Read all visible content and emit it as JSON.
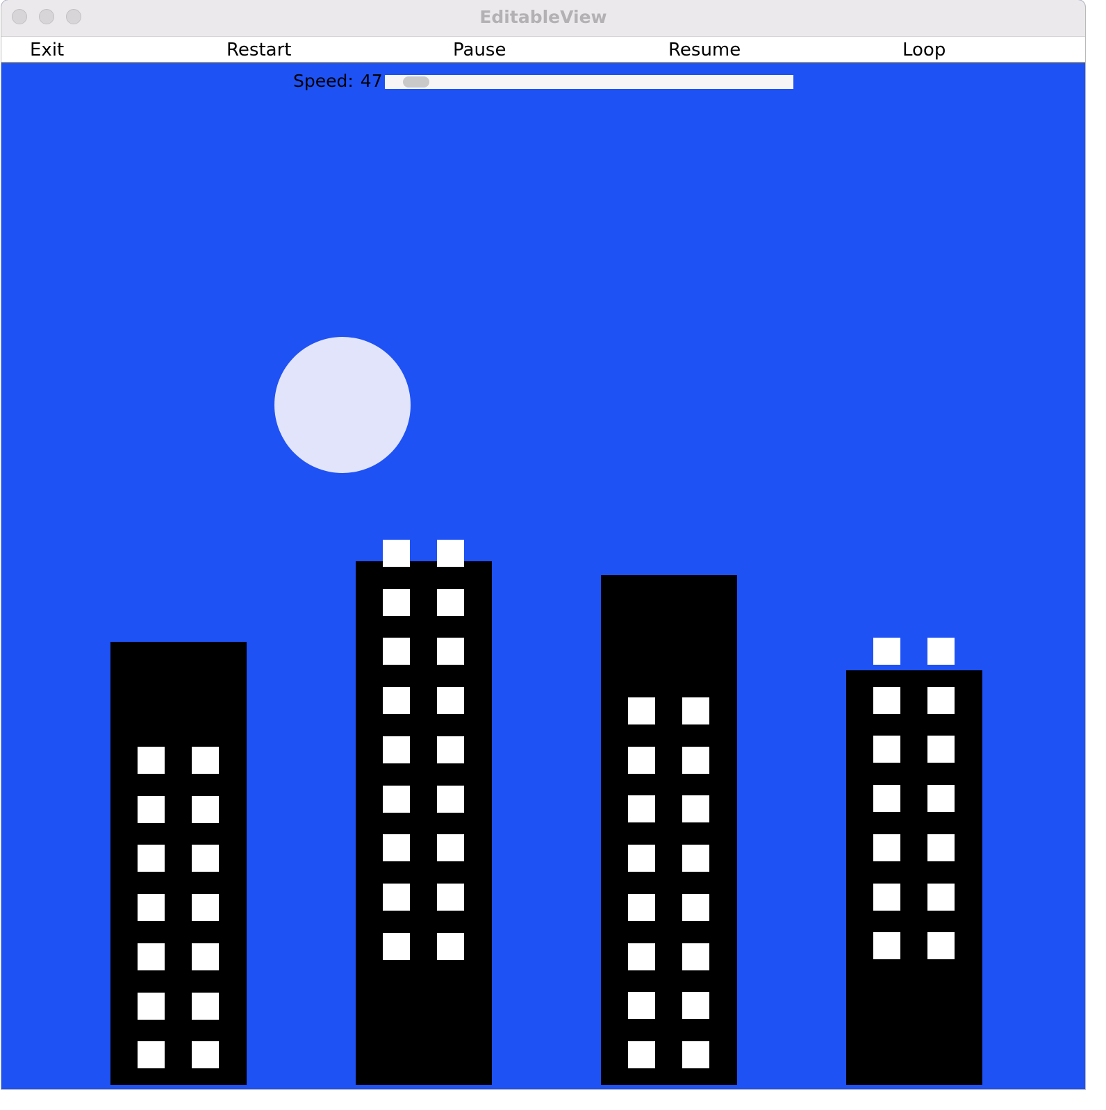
{
  "window": {
    "title": "EditableView"
  },
  "menu": {
    "items": [
      {
        "id": "exit",
        "label": "Exit"
      },
      {
        "id": "restart",
        "label": "Restart"
      },
      {
        "id": "pause",
        "label": "Pause"
      },
      {
        "id": "resume",
        "label": "Resume"
      },
      {
        "id": "loop",
        "label": "Loop"
      }
    ]
  },
  "speed": {
    "label": "Speed:",
    "value": "47"
  },
  "scene": {
    "sky_color": "#1e52f5",
    "moon_color": "#e2e4fb",
    "building_color": "#000000",
    "window_color": "#ffffff"
  }
}
